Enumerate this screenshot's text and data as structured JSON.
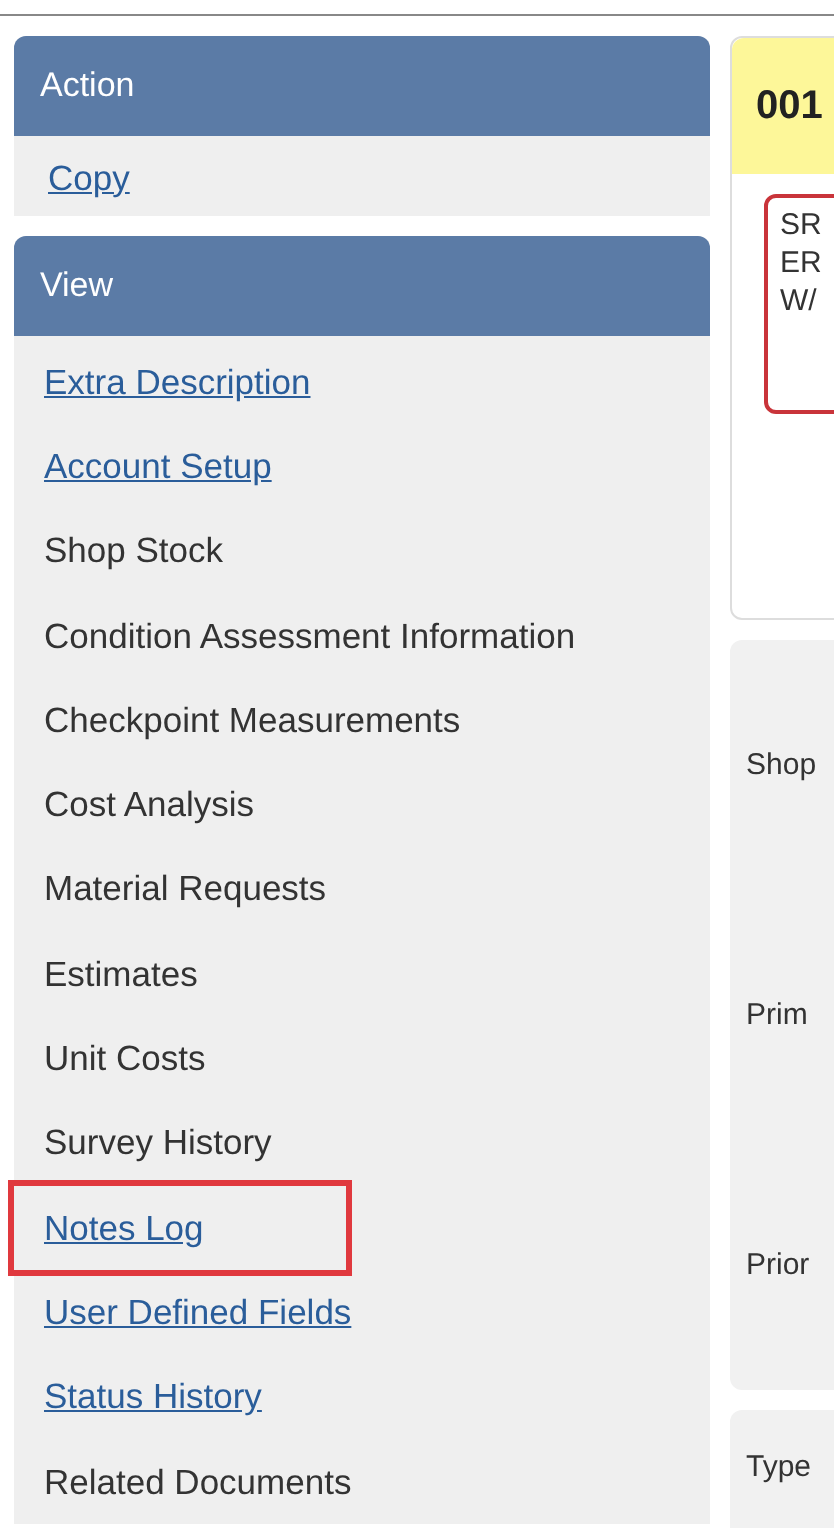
{
  "sidebar": {
    "sections": [
      {
        "title": "Action",
        "items": [
          {
            "label": "Copy",
            "kind": "link",
            "highlighted": false
          }
        ]
      },
      {
        "title": "View",
        "items": [
          {
            "label": "Extra Description",
            "kind": "link",
            "highlighted": false
          },
          {
            "label": "Account Setup",
            "kind": "link",
            "highlighted": false
          },
          {
            "label": "Shop Stock",
            "kind": "text",
            "highlighted": false
          },
          {
            "label": "Condition Assessment Information",
            "kind": "text",
            "highlighted": false
          },
          {
            "label": "Checkpoint Measurements",
            "kind": "text",
            "highlighted": false
          },
          {
            "label": "Cost Analysis",
            "kind": "text",
            "highlighted": false
          },
          {
            "label": "Material Requests",
            "kind": "text",
            "highlighted": false
          },
          {
            "label": "Estimates",
            "kind": "text",
            "highlighted": false
          },
          {
            "label": "Unit Costs",
            "kind": "text",
            "highlighted": false
          },
          {
            "label": "Survey History",
            "kind": "text",
            "highlighted": false
          },
          {
            "label": "Notes Log",
            "kind": "link",
            "highlighted": true
          },
          {
            "label": "User Defined Fields",
            "kind": "link",
            "highlighted": false
          },
          {
            "label": "Status History",
            "kind": "link",
            "highlighted": false
          },
          {
            "label": "Related Documents",
            "kind": "text",
            "highlighted": false
          }
        ]
      }
    ]
  },
  "main": {
    "header": "001",
    "note_lines": [
      "SR",
      "ER",
      "W/"
    ],
    "field_labels": [
      "Shop",
      "Prim",
      "Prior"
    ],
    "next_panel_label": "Type"
  }
}
